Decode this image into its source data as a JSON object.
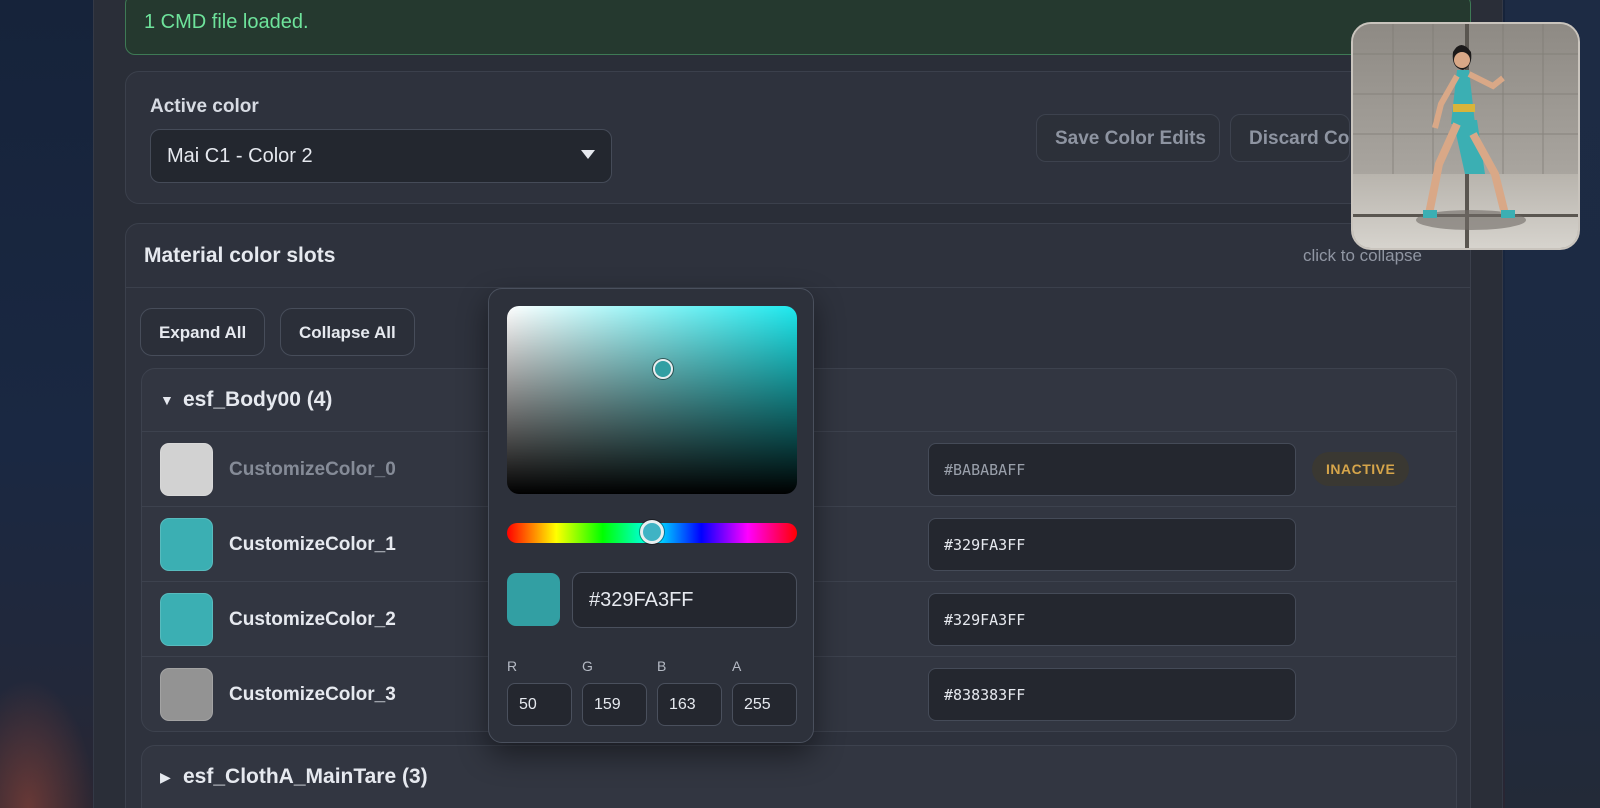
{
  "banner": {
    "text": "1 CMD file loaded."
  },
  "active_color": {
    "label": "Active color",
    "selected": "Mai C1 - Color 2",
    "save_label": "Save Color Edits",
    "discard_label": "Discard Color Edits"
  },
  "material_slots": {
    "title": "Material color slots",
    "hint": "click to collapse",
    "expand_all": "Expand All",
    "collapse_all": "Collapse All",
    "groups": [
      {
        "title": "esf_Body00 (4)",
        "caret": "▼",
        "slots": [
          {
            "name": "CustomizeColor_0",
            "hex": "#BABABAFF",
            "swatch": "#d2d2d2",
            "badge": "INACTIVE"
          },
          {
            "name": "CustomizeColor_1",
            "hex": "#329FA3FF",
            "swatch": "#3bafb3"
          },
          {
            "name": "CustomizeColor_2",
            "hex": "#329FA3FF",
            "swatch": "#3bafb3"
          },
          {
            "name": "CustomizeColor_3",
            "hex": "#838383FF",
            "swatch": "#939393"
          }
        ]
      },
      {
        "title": "esf_ClothA_MainTare (3)",
        "caret": "▶"
      }
    ]
  },
  "picker": {
    "hex": "#329FA3FF",
    "channels": [
      {
        "label": "R",
        "value": "50"
      },
      {
        "label": "G",
        "value": "159"
      },
      {
        "label": "B",
        "value": "163"
      },
      {
        "label": "A",
        "value": "255"
      }
    ]
  },
  "colors": {
    "accent": "#329FA3",
    "banner_text": "#6EE39B",
    "inactive_badge": "#D6A54A"
  }
}
